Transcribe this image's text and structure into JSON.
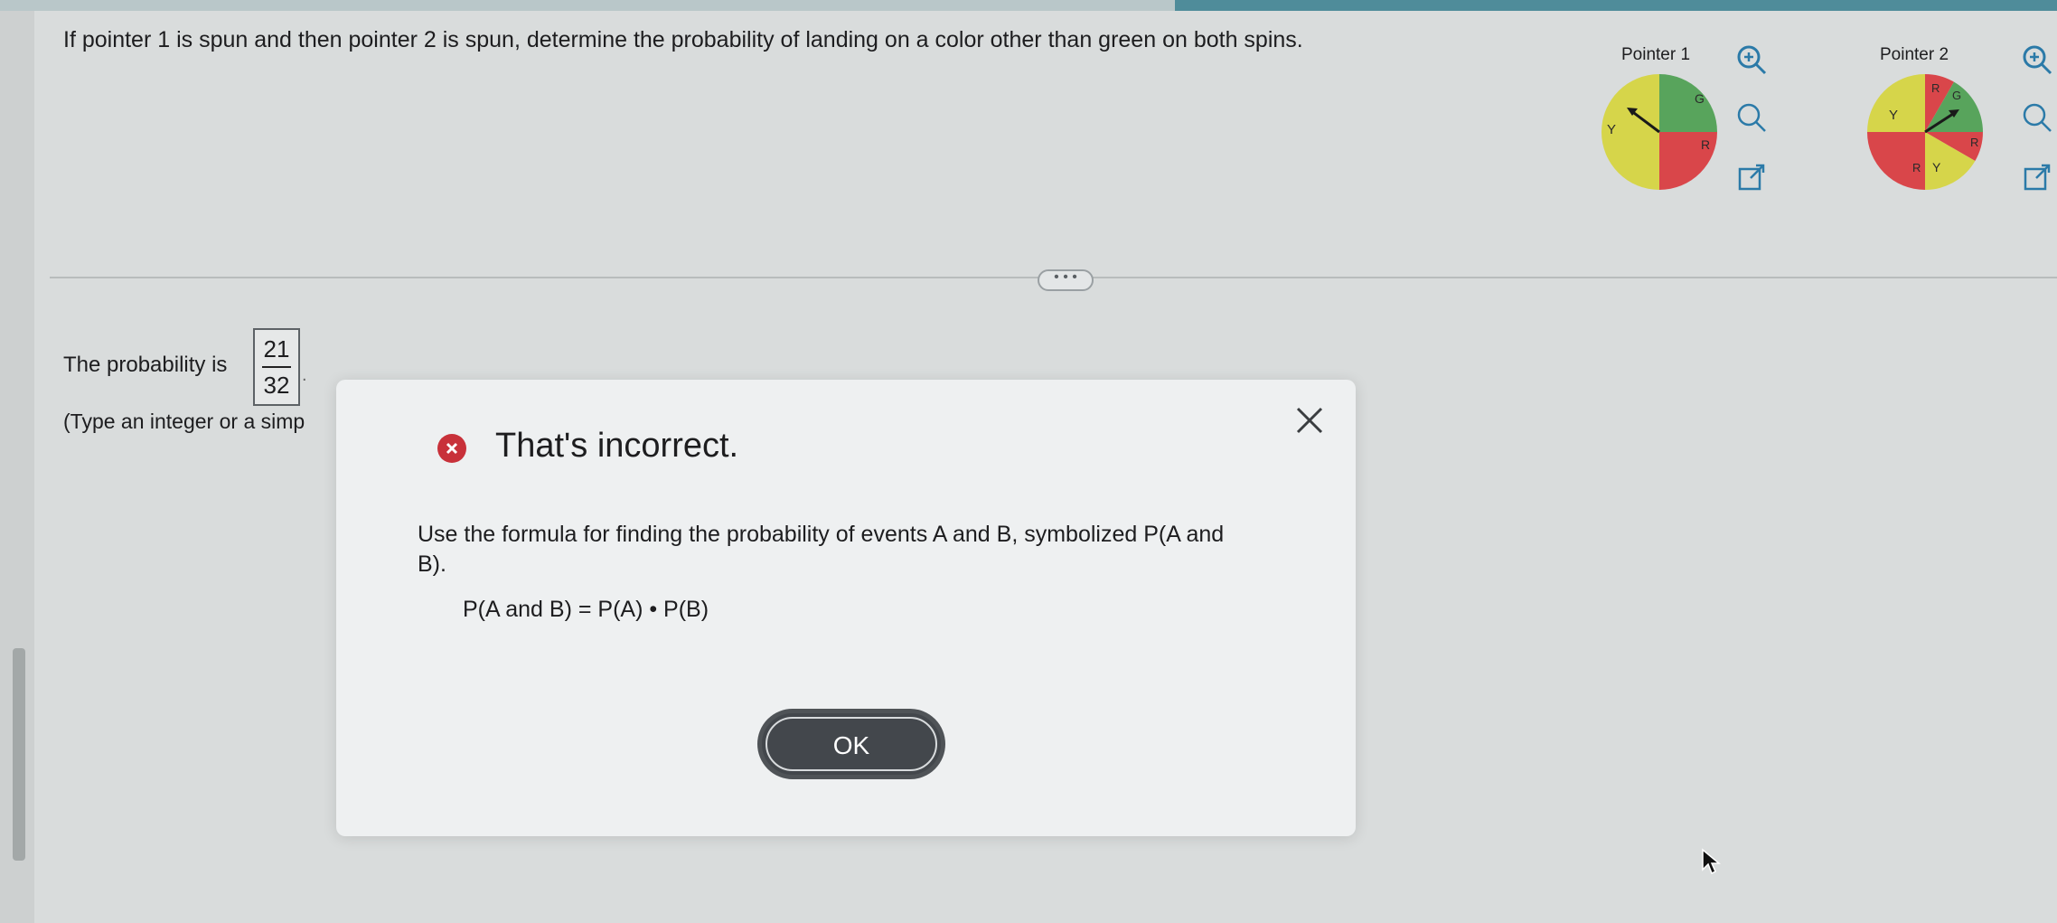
{
  "question": "If pointer 1 is spun and then pointer 2 is spun, determine the probability of landing on a color other than green on both spins.",
  "pointer1": {
    "title": "Pointer 1",
    "sector_labels": [
      "G",
      "R",
      "Y"
    ],
    "colors": {
      "green": "#58a45c",
      "red": "#d9464a",
      "yellow": "#d6d54a"
    },
    "icons": [
      "zoom-in-icon",
      "zoom-out-icon",
      "expand-icon"
    ]
  },
  "pointer2": {
    "title": "Pointer 2",
    "sector_labels": [
      "R",
      "G",
      "R",
      "Y",
      "R",
      "Y"
    ],
    "icons": [
      "zoom-in-icon",
      "zoom-out-icon",
      "expand-icon"
    ]
  },
  "more_button": "• • •",
  "answer": {
    "prefix": "The probability is",
    "numerator": "21",
    "denominator": "32",
    "suffix": ".",
    "hint": "(Type an integer or a simp"
  },
  "dialog": {
    "heading": "That's incorrect.",
    "body": "Use the formula for finding the probability of events A and B, symbolized P(A and B).",
    "formula": "P(A and B) = P(A) • P(B)",
    "ok_label": "OK",
    "error_color": "#c8313a"
  }
}
